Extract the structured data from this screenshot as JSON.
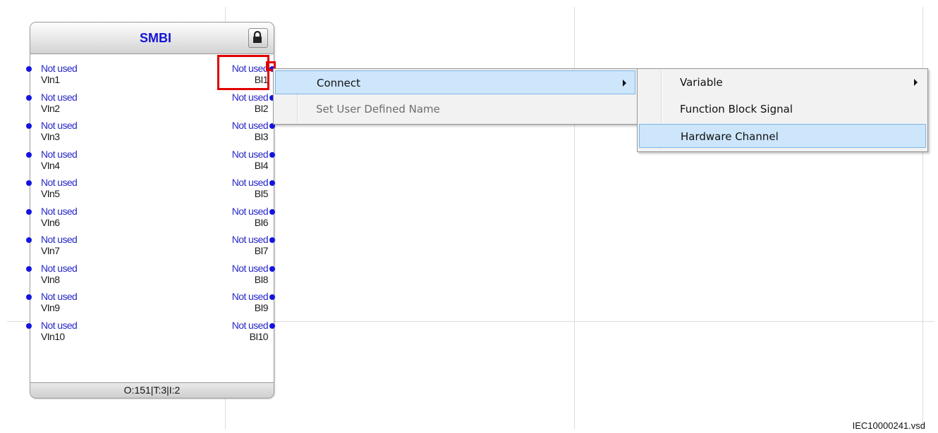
{
  "block": {
    "title": "SMBI",
    "footer": "O:151|T:3|I:2",
    "lock_icon": "lock-icon",
    "inputs": [
      {
        "signal": "Not used",
        "name": "VIn1"
      },
      {
        "signal": "Not used",
        "name": "VIn2"
      },
      {
        "signal": "Not used",
        "name": "VIn3"
      },
      {
        "signal": "Not used",
        "name": "VIn4"
      },
      {
        "signal": "Not used",
        "name": "VIn5"
      },
      {
        "signal": "Not used",
        "name": "VIn6"
      },
      {
        "signal": "Not used",
        "name": "VIn7"
      },
      {
        "signal": "Not used",
        "name": "VIn8"
      },
      {
        "signal": "Not used",
        "name": "VIn9"
      },
      {
        "signal": "Not used",
        "name": "VIn10"
      }
    ],
    "outputs": [
      {
        "signal": "Not used",
        "name": "BI1"
      },
      {
        "signal": "Not used",
        "name": "BI2"
      },
      {
        "signal": "Not used",
        "name": "BI3"
      },
      {
        "signal": "Not used",
        "name": "BI4"
      },
      {
        "signal": "Not used",
        "name": "BI5"
      },
      {
        "signal": "Not used",
        "name": "BI6"
      },
      {
        "signal": "Not used",
        "name": "BI7"
      },
      {
        "signal": "Not used",
        "name": "BI8"
      },
      {
        "signal": "Not used",
        "name": "BI9"
      },
      {
        "signal": "Not used",
        "name": "BI10"
      }
    ]
  },
  "context_menu": {
    "items": [
      {
        "label": "Connect",
        "submenu": true,
        "highlighted": true,
        "enabled": true
      },
      {
        "label": "Set User Defined Name",
        "submenu": false,
        "highlighted": false,
        "enabled": false
      }
    ]
  },
  "connect_submenu": {
    "items": [
      {
        "label": "Variable",
        "submenu": true,
        "highlighted": false
      },
      {
        "label": "Function Block Signal",
        "submenu": false,
        "highlighted": false
      },
      {
        "label": "Hardware Channel",
        "submenu": false,
        "highlighted": true
      }
    ]
  },
  "colors": {
    "signal_text": "#2828c8",
    "pin_dot": "#1414e0",
    "selection_outline": "#e00000",
    "menu_highlight": "#cde6fb"
  },
  "caption": "IEC10000241.vsd"
}
